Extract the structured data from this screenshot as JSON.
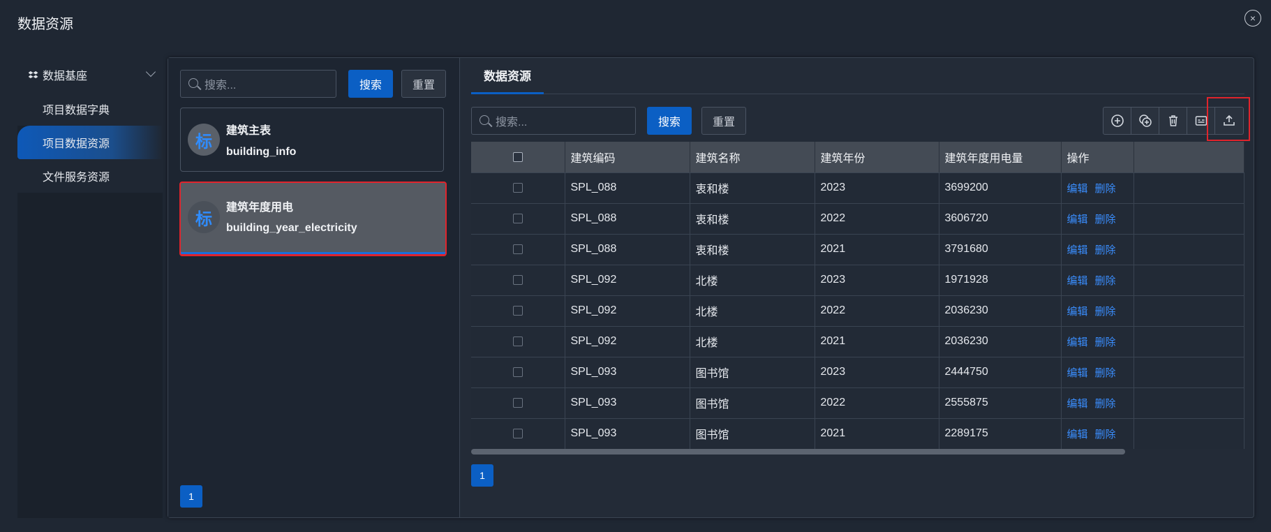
{
  "window": {
    "title": "数据资源",
    "close_glyph": "×"
  },
  "nav": {
    "group_label": "数据基座",
    "items": [
      {
        "label": "项目数据字典",
        "active": false
      },
      {
        "label": "项目数据资源",
        "active": true
      },
      {
        "label": "文件服务资源",
        "active": false
      }
    ]
  },
  "left": {
    "search_placeholder": "搜索...",
    "search_label": "搜索",
    "reset_label": "重置",
    "cards": [
      {
        "badge": "标",
        "title": "建筑主表",
        "subtitle": "building_info",
        "selected": false
      },
      {
        "badge": "标",
        "title": "建筑年度用电",
        "subtitle": "building_year_electricity",
        "selected": true
      }
    ],
    "page": "1"
  },
  "right": {
    "tab_label": "数据资源",
    "search_placeholder": "搜索...",
    "search_label": "搜索",
    "reset_label": "重置",
    "toolbar_icons": [
      "add-circle-icon",
      "copy-add-icon",
      "trash-icon",
      "card-icon",
      "upload-icon"
    ],
    "columns": [
      "建筑编码",
      "建筑名称",
      "建筑年份",
      "建筑年度用电量",
      "操作"
    ],
    "rows": [
      {
        "code": "SPL_088",
        "name": "衷和楼",
        "year": "2023",
        "usage": "3699200"
      },
      {
        "code": "SPL_088",
        "name": "衷和楼",
        "year": "2022",
        "usage": "3606720"
      },
      {
        "code": "SPL_088",
        "name": "衷和楼",
        "year": "2021",
        "usage": "3791680"
      },
      {
        "code": "SPL_092",
        "name": "北楼",
        "year": "2023",
        "usage": "1971928"
      },
      {
        "code": "SPL_092",
        "name": "北楼",
        "year": "2022",
        "usage": "2036230"
      },
      {
        "code": "SPL_092",
        "name": "北楼",
        "year": "2021",
        "usage": "2036230"
      },
      {
        "code": "SPL_093",
        "name": "图书馆",
        "year": "2023",
        "usage": "2444750"
      },
      {
        "code": "SPL_093",
        "name": "图书馆",
        "year": "2022",
        "usage": "2555875"
      },
      {
        "code": "SPL_093",
        "name": "图书馆",
        "year": "2021",
        "usage": "2289175"
      }
    ],
    "edit_label": "编辑",
    "delete_label": "删除",
    "page": "1"
  },
  "colors": {
    "primary": "#0b5fc4",
    "link": "#3a8eff",
    "highlight": "#e0242c"
  }
}
